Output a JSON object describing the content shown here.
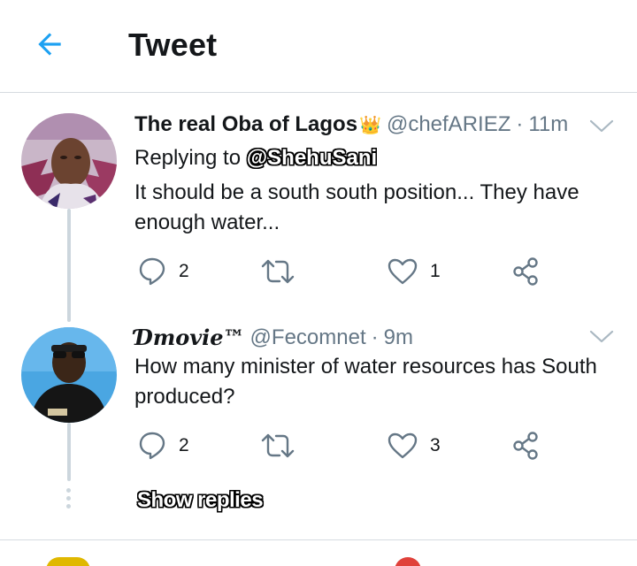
{
  "header": {
    "title": "Tweet",
    "accent_color": "#1da1f2",
    "back_icon": "arrow-left-icon"
  },
  "tweets": [
    {
      "display_name": "The real Oba of Lagos",
      "name_emoji": "👑",
      "handle": "@chefARIEZ",
      "separator": "·",
      "time": "11m",
      "replying_prefix": "Replying to",
      "replying_to": "@ShehuSani",
      "text": "It should be a south south position... They have enough water...",
      "reply_count": "2",
      "retweet_count": "",
      "like_count": "1"
    },
    {
      "display_name": "Ɗmovie™",
      "handle": "@Fecomnet",
      "separator": "·",
      "time": "9m",
      "text": "How many minister of water resources has South produced?",
      "reply_count": "2",
      "retweet_count": "",
      "like_count": "3"
    }
  ],
  "show_replies_label": "Show replies",
  "icons": {
    "reply": "reply-bubble-icon",
    "retweet": "retweet-icon",
    "like": "heart-icon",
    "share": "share-icon",
    "menu": "chevron-down-icon"
  }
}
